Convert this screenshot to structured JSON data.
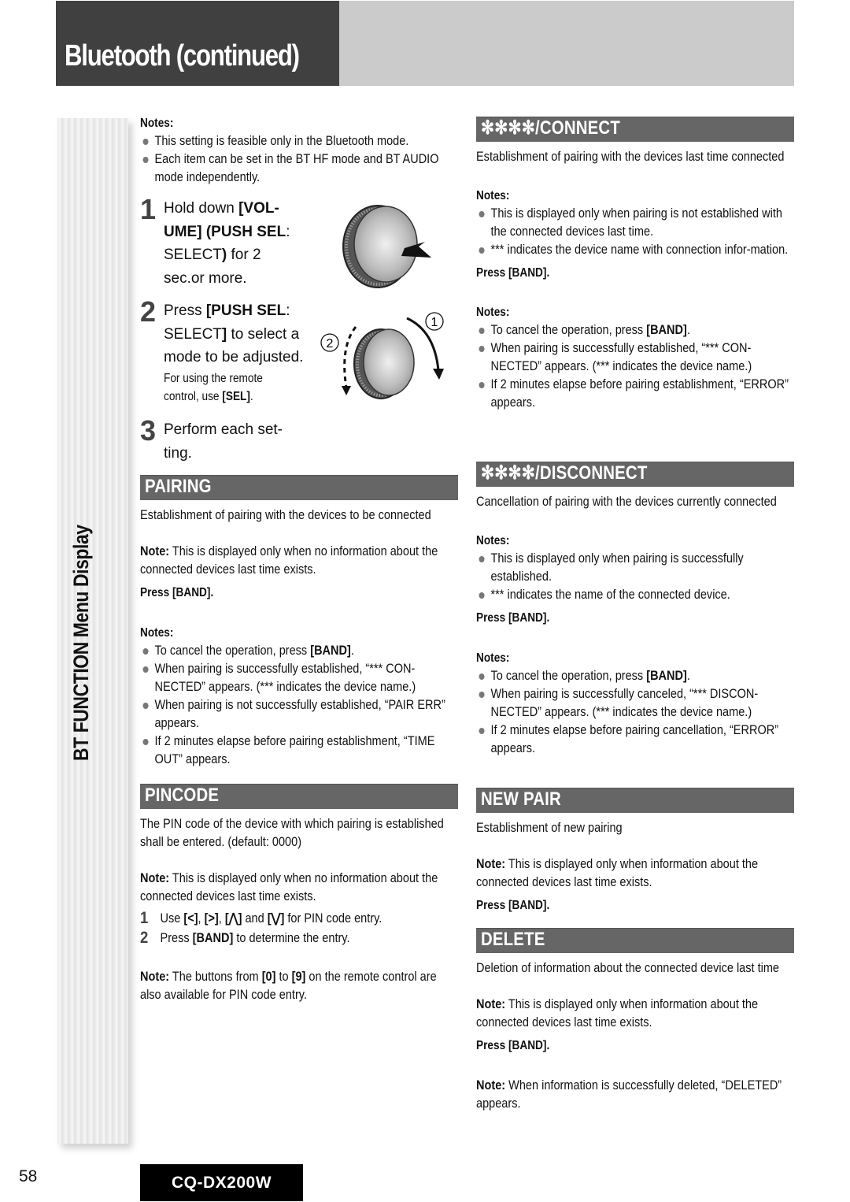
{
  "header": {
    "title": "Bluetooth (continued)"
  },
  "side_tab": {
    "label": "BT FUNCTION Menu Display"
  },
  "intro_notes": {
    "heading": "Notes:",
    "items": [
      "This setting is feasible only in the Bluetooth mode.",
      "Each item can be set in the BT HF mode and BT AUDIO mode independently."
    ]
  },
  "steps": [
    {
      "num": "1",
      "lines": [
        {
          "pre": "Hold down ",
          "bold": "[VOL-",
          "post": ""
        },
        {
          "pre": "",
          "bold": "UME] (PUSH SEL",
          "post": ":"
        },
        {
          "pre": "SELECT",
          "bold": ")",
          "post": " for 2"
        },
        {
          "pre": "sec.or more.",
          "bold": "",
          "post": ""
        }
      ]
    },
    {
      "num": "2",
      "lines": [
        {
          "pre": "Press ",
          "bold": "[PUSH SEL",
          "post": ":"
        },
        {
          "pre": "SELECT",
          "bold": "]",
          "post": " to select a"
        },
        {
          "pre": "mode to be adjusted.",
          "bold": "",
          "post": ""
        }
      ],
      "remote_note": {
        "line1": "For using the remote",
        "line2_pre": "control, use ",
        "line2_bold": "[SEL]",
        "line2_post": "."
      }
    },
    {
      "num": "3",
      "lines": [
        {
          "pre": "Perform each set-",
          "bold": "",
          "post": ""
        },
        {
          "pre": "ting.",
          "bold": "",
          "post": ""
        }
      ]
    }
  ],
  "knob_labels": {
    "rotate_cw": "①",
    "rotate_ccw": "②"
  },
  "sections": {
    "pairing": {
      "title": "PAIRING",
      "description": "Establishment of pairing with the devices to be connected",
      "note_label": "Note:",
      "note": " This is displayed only when no information about the connected devices last time exists.",
      "press": "Press [BAND].",
      "notes_heading": "Notes:",
      "notes": [
        {
          "pre": "To cancel the operation, press ",
          "bold": "[BAND]",
          "post": "."
        },
        {
          "pre": "When pairing is successfully established, “*** CON-NECTED” appears. (*** indicates the device name.)",
          "bold": "",
          "post": ""
        },
        {
          "pre": "When pairing is not successfully established, “PAIR ERR” appears.",
          "bold": "",
          "post": ""
        },
        {
          "pre": "If 2 minutes elapse before pairing establishment, “TIME OUT” appears.",
          "bold": "",
          "post": ""
        }
      ]
    },
    "pincode": {
      "title": "PINCODE",
      "description": "The PIN code of the device with which pairing is established shall be entered. (default: 0000)",
      "note_label": "Note:",
      "note": " This is displayed only when no information about the connected devices last time exists.",
      "steps": [
        {
          "num": "1",
          "text_a": "Use ",
          "k1": "[<]",
          "sep1": ", ",
          "k2": "[>]",
          "sep2": ", ",
          "k3": "[⋀]",
          "sep3": " and ",
          "k4": "[⋁]",
          "text_b": " for PIN code entry."
        },
        {
          "num": "2",
          "text_a": "Press ",
          "k1": "[BAND]",
          "text_b": " to determine the entry."
        }
      ],
      "note2_label": "Note:",
      "note2_a": " The buttons from ",
      "note2_k1": "[0]",
      "note2_b": " to ",
      "note2_k2": "[9]",
      "note2_c": " on the remote control are also available for PIN code entry."
    },
    "connect": {
      "title": "✻✻✻✻/CONNECT",
      "description": "Establishment of pairing with the devices last time connected",
      "notes_heading": "Notes:",
      "notes": [
        "This is displayed only when pairing is not established with the connected devices last time.",
        "*** indicates the device name with connection infor-mation."
      ],
      "press": "Press [BAND].",
      "notes2_heading": "Notes:",
      "notes2": [
        {
          "pre": "To cancel the operation, press ",
          "bold": "[BAND]",
          "post": "."
        },
        {
          "pre": "When pairing is successfully established, “*** CON-NECTED” appears. (*** indicates the device name.)",
          "bold": "",
          "post": ""
        },
        {
          "pre": "If 2 minutes elapse before pairing establishment, “ERROR” appears.",
          "bold": "",
          "post": ""
        }
      ]
    },
    "disconnect": {
      "title": "✻✻✻✻/DISCONNECT",
      "description": "Cancellation of pairing with the devices currently connected",
      "notes_heading": "Notes:",
      "notes": [
        "This is displayed only when pairing is successfully established.",
        "*** indicates the name of the connected device."
      ],
      "press": "Press [BAND].",
      "notes2_heading": "Notes:",
      "notes2": [
        {
          "pre": "To cancel the operation, press ",
          "bold": "[BAND]",
          "post": "."
        },
        {
          "pre": "When pairing is successfully canceled, “*** DISCON-NECTED” appears. (*** indicates the device name.)",
          "bold": "",
          "post": ""
        },
        {
          "pre": "If 2 minutes elapse before pairing cancellation, “ERROR” appears.",
          "bold": "",
          "post": ""
        }
      ]
    },
    "new_pair": {
      "title": "NEW PAIR",
      "description": "Establishment of new pairing",
      "note_label": "Note:",
      "note": " This is displayed only when information about the connected devices last time exists.",
      "press": "Press [BAND]."
    },
    "delete": {
      "title": "DELETE",
      "description": "Deletion of information about the connected device last time",
      "note_label": "Note:",
      "note": " This is displayed only when information about the connected devices last time exists.",
      "press": "Press [BAND].",
      "note2_label": "Note:",
      "note2": " When information is successfully deleted, “DELETED” appears."
    }
  },
  "footer": {
    "page_number": "58",
    "model": "CQ-DX200W"
  },
  "colors": {
    "header_dark": "#404040",
    "header_light": "#cbcbcb",
    "section_bar": "#666666",
    "model_badge": "#000000"
  }
}
